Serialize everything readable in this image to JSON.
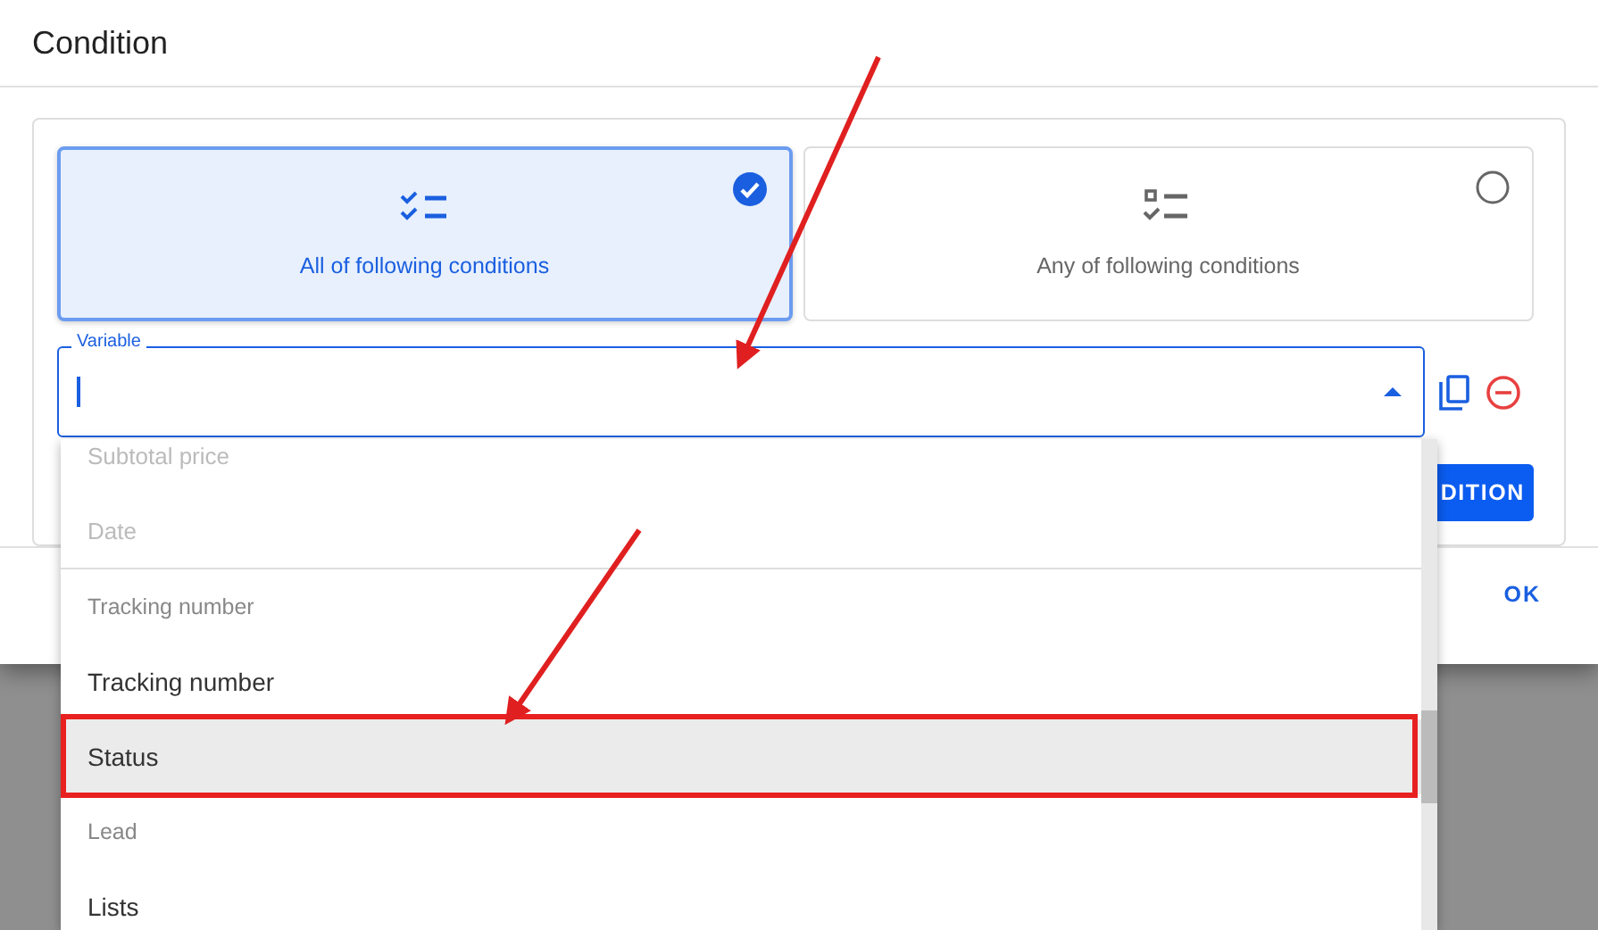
{
  "dialog": {
    "title": "Condition",
    "modes": [
      {
        "kind": "all",
        "label": "All of following conditions",
        "selected": true
      },
      {
        "kind": "any",
        "label": "Any of following conditions",
        "selected": false
      }
    ],
    "variable_field": {
      "label": "Variable",
      "expanded": true
    },
    "add_button": "DITION",
    "footer_button": "OK"
  },
  "dropdown": {
    "items": [
      {
        "kind": "option",
        "label": "Subtotal price",
        "disabled": true,
        "highlighted": false
      },
      {
        "kind": "option",
        "label": "Date",
        "disabled": true,
        "highlighted": false
      },
      {
        "kind": "divider"
      },
      {
        "kind": "header",
        "label": "Tracking number"
      },
      {
        "kind": "option",
        "label": "Tracking number",
        "disabled": false,
        "highlighted": false
      },
      {
        "kind": "option",
        "label": "Status",
        "disabled": false,
        "highlighted": true
      },
      {
        "kind": "header",
        "label": "Lead"
      },
      {
        "kind": "option",
        "label": "Lists",
        "disabled": false,
        "highlighted": false
      }
    ]
  }
}
